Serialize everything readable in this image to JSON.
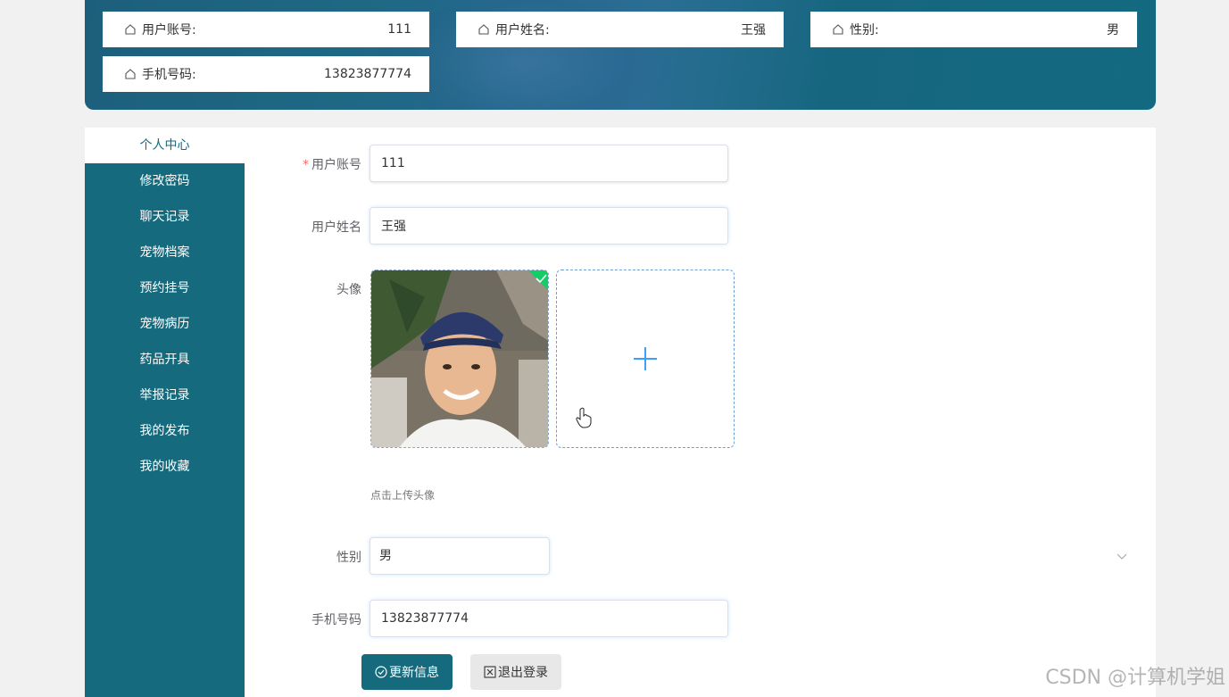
{
  "header": {
    "cards": [
      {
        "label": "用户账号:",
        "value": "111",
        "icon": "home-icon"
      },
      {
        "label": "用户姓名:",
        "value": "王强",
        "icon": "home-icon"
      },
      {
        "label": "性别:",
        "value": "男",
        "icon": "home-icon"
      },
      {
        "label": "手机号码:",
        "value": "13823877774",
        "icon": "home-icon"
      }
    ]
  },
  "sidebar": {
    "items": [
      {
        "label": "个人中心",
        "active": true
      },
      {
        "label": "修改密码"
      },
      {
        "label": "聊天记录"
      },
      {
        "label": "宠物档案"
      },
      {
        "label": "预约挂号"
      },
      {
        "label": "宠物病历"
      },
      {
        "label": "药品开具"
      },
      {
        "label": "举报记录"
      },
      {
        "label": "我的发布"
      },
      {
        "label": "我的收藏"
      }
    ]
  },
  "form": {
    "account": {
      "required_mark": "*",
      "label": "用户账号",
      "value": "111"
    },
    "name": {
      "label": "用户姓名",
      "value": "王强"
    },
    "avatar": {
      "label": "头像",
      "tip": "点击上传头像",
      "upload_icon": "plus-icon"
    },
    "gender": {
      "label": "性别",
      "value": "男"
    },
    "phone": {
      "label": "手机号码",
      "value": "13823877774"
    },
    "buttons": {
      "update": "更新信息",
      "logout": "退出登录"
    }
  },
  "watermark": "CSDN @计算机学姐",
  "colors": {
    "primary": "#156a7e",
    "accent": "#409eff",
    "success": "#13ce66"
  }
}
